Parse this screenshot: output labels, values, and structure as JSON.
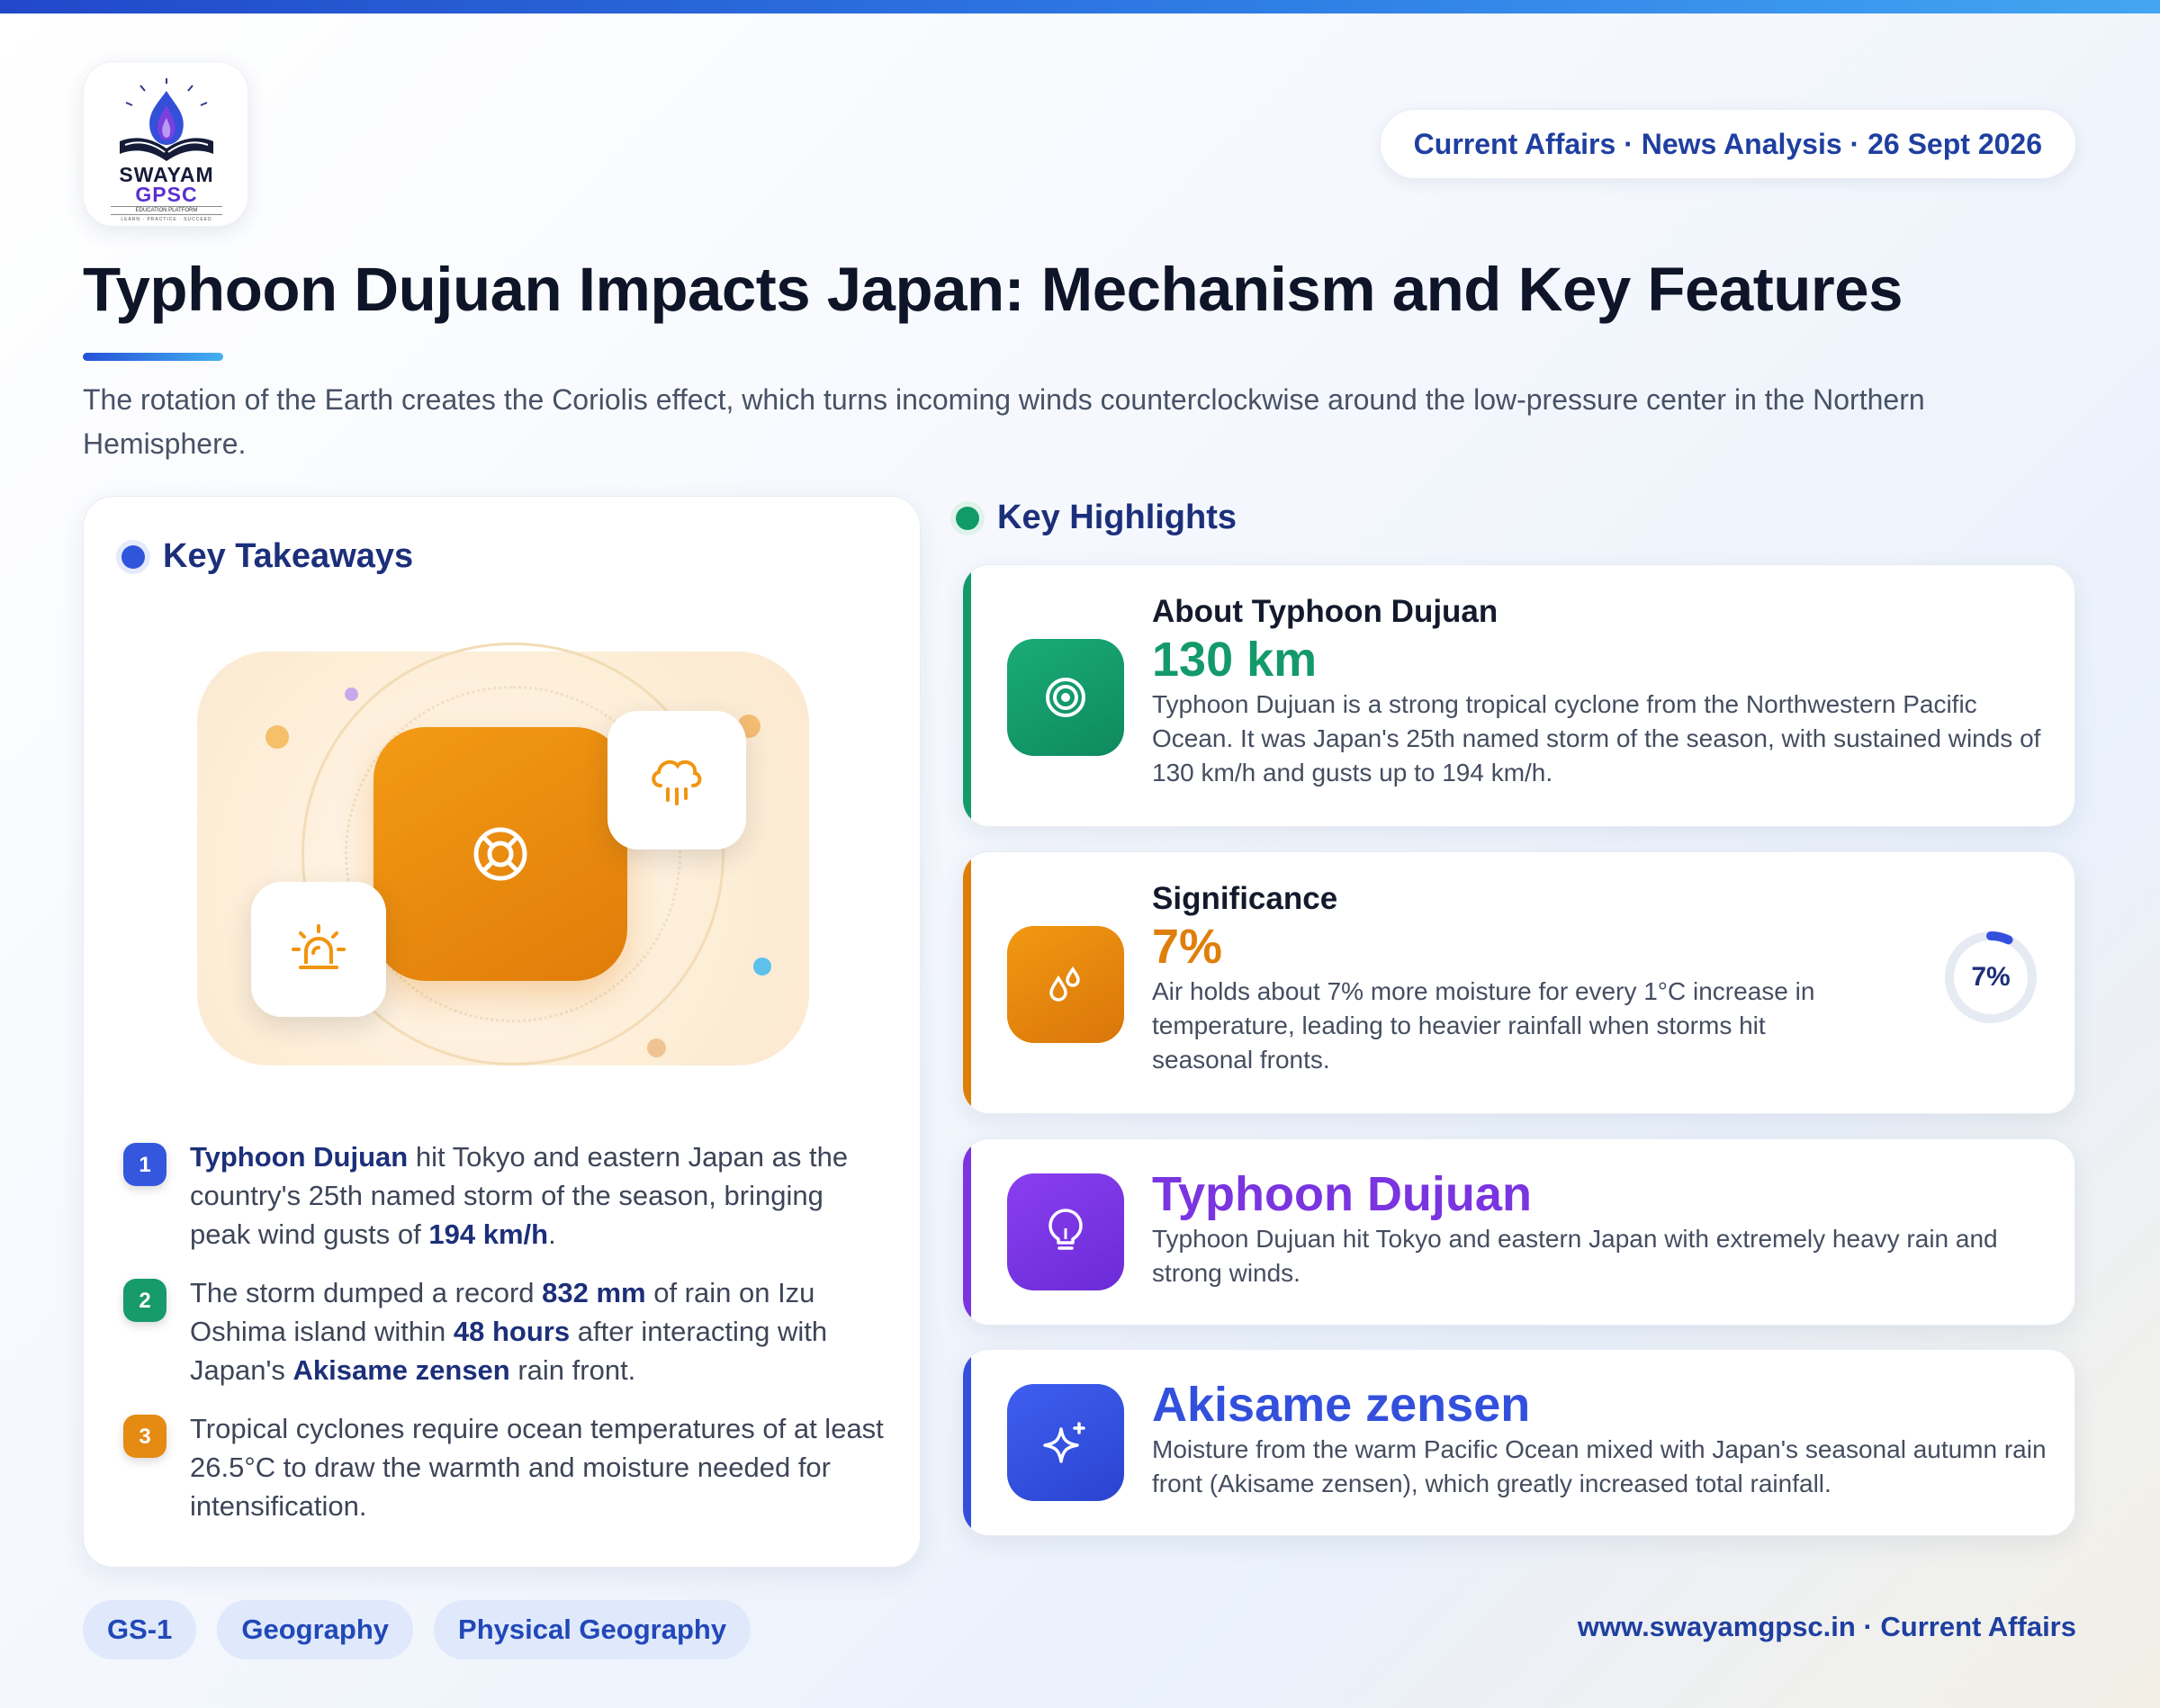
{
  "brand": {
    "logo_line1": "SWAYAM",
    "logo_line2": "GPSC",
    "logo_tagline": "EDUCATION PLATFORM",
    "logo_motto": "LEARN · PRACTICE · SUCCEED"
  },
  "header": {
    "date_pill": "Current Affairs · News Analysis · 26 Sept 2026",
    "title": "Typhoon Dujuan Impacts Japan: Mechanism and Key Features",
    "subtitle": "The rotation of the Earth creates the Coriolis effect, which turns incoming winds counterclockwise around the low-pressure center in the Northern Hemisphere."
  },
  "takeaways": {
    "heading": "Key Takeaways",
    "items": [
      {
        "num": "1",
        "color": "#3557dd",
        "parts": [
          {
            "b": true,
            "t": "Typhoon Dujuan"
          },
          {
            "t": " hit Tokyo and eastern Japan as the country's 25th named storm of the season, bringing peak wind gusts of "
          },
          {
            "b": true,
            "t": "194 km/h"
          },
          {
            "t": "."
          }
        ]
      },
      {
        "num": "2",
        "color": "#179a6c",
        "parts": [
          {
            "t": "The storm dumped a record "
          },
          {
            "b": true,
            "t": "832 mm"
          },
          {
            "t": " of rain on Izu Oshima island within "
          },
          {
            "b": true,
            "t": "48 hours"
          },
          {
            "t": " after interacting with Japan's "
          },
          {
            "b": true,
            "t": "Akisame zensen"
          },
          {
            "t": " rain front."
          }
        ]
      },
      {
        "num": "3",
        "color": "#e58a12",
        "parts": [
          {
            "t": "Tropical cyclones require ocean temperatures of at least 26.5°C to draw the warmth and moisture needed for intensification."
          }
        ]
      }
    ]
  },
  "highlights": {
    "heading": "Key Highlights",
    "cards": [
      {
        "title": "About Typhoon Dujuan",
        "big": "130 km",
        "text": "Typhoon Dujuan is a strong tropical cyclone from the Northwestern Pacific Ocean. It was Japan's 25th named storm of the season, with sustained winds of 130 km/h and gusts up to 194 km/h.",
        "accent": "#149a6a",
        "icon": "target-icon"
      },
      {
        "title": "Significance",
        "big": "7%",
        "text": "Air holds about 7% more moisture for every 1°C increase in temperature, leading to heavier rainfall when storms hit seasonal fronts.",
        "accent": "#df7f0b",
        "icon": "droplets-icon",
        "ring_label": "7%",
        "ring_fraction": 0.07
      },
      {
        "title": "",
        "big": "Typhoon Dujuan",
        "text": "Typhoon Dujuan hit Tokyo and eastern Japan with extremely heavy rain and strong winds.",
        "accent": "#7a34e0",
        "icon": "lightbulb-icon"
      },
      {
        "title": "",
        "big": "Akisame zensen",
        "text": "Moisture from the warm Pacific Ocean mixed with Japan's seasonal autumn rain front (Akisame zensen), which greatly increased total rainfall.",
        "accent": "#3350dd",
        "icon": "sparkles-icon"
      }
    ]
  },
  "footer": {
    "tags": [
      "GS-1",
      "Geography",
      "Physical Geography"
    ],
    "site": "www.swayamgpsc.in · Current Affairs"
  }
}
